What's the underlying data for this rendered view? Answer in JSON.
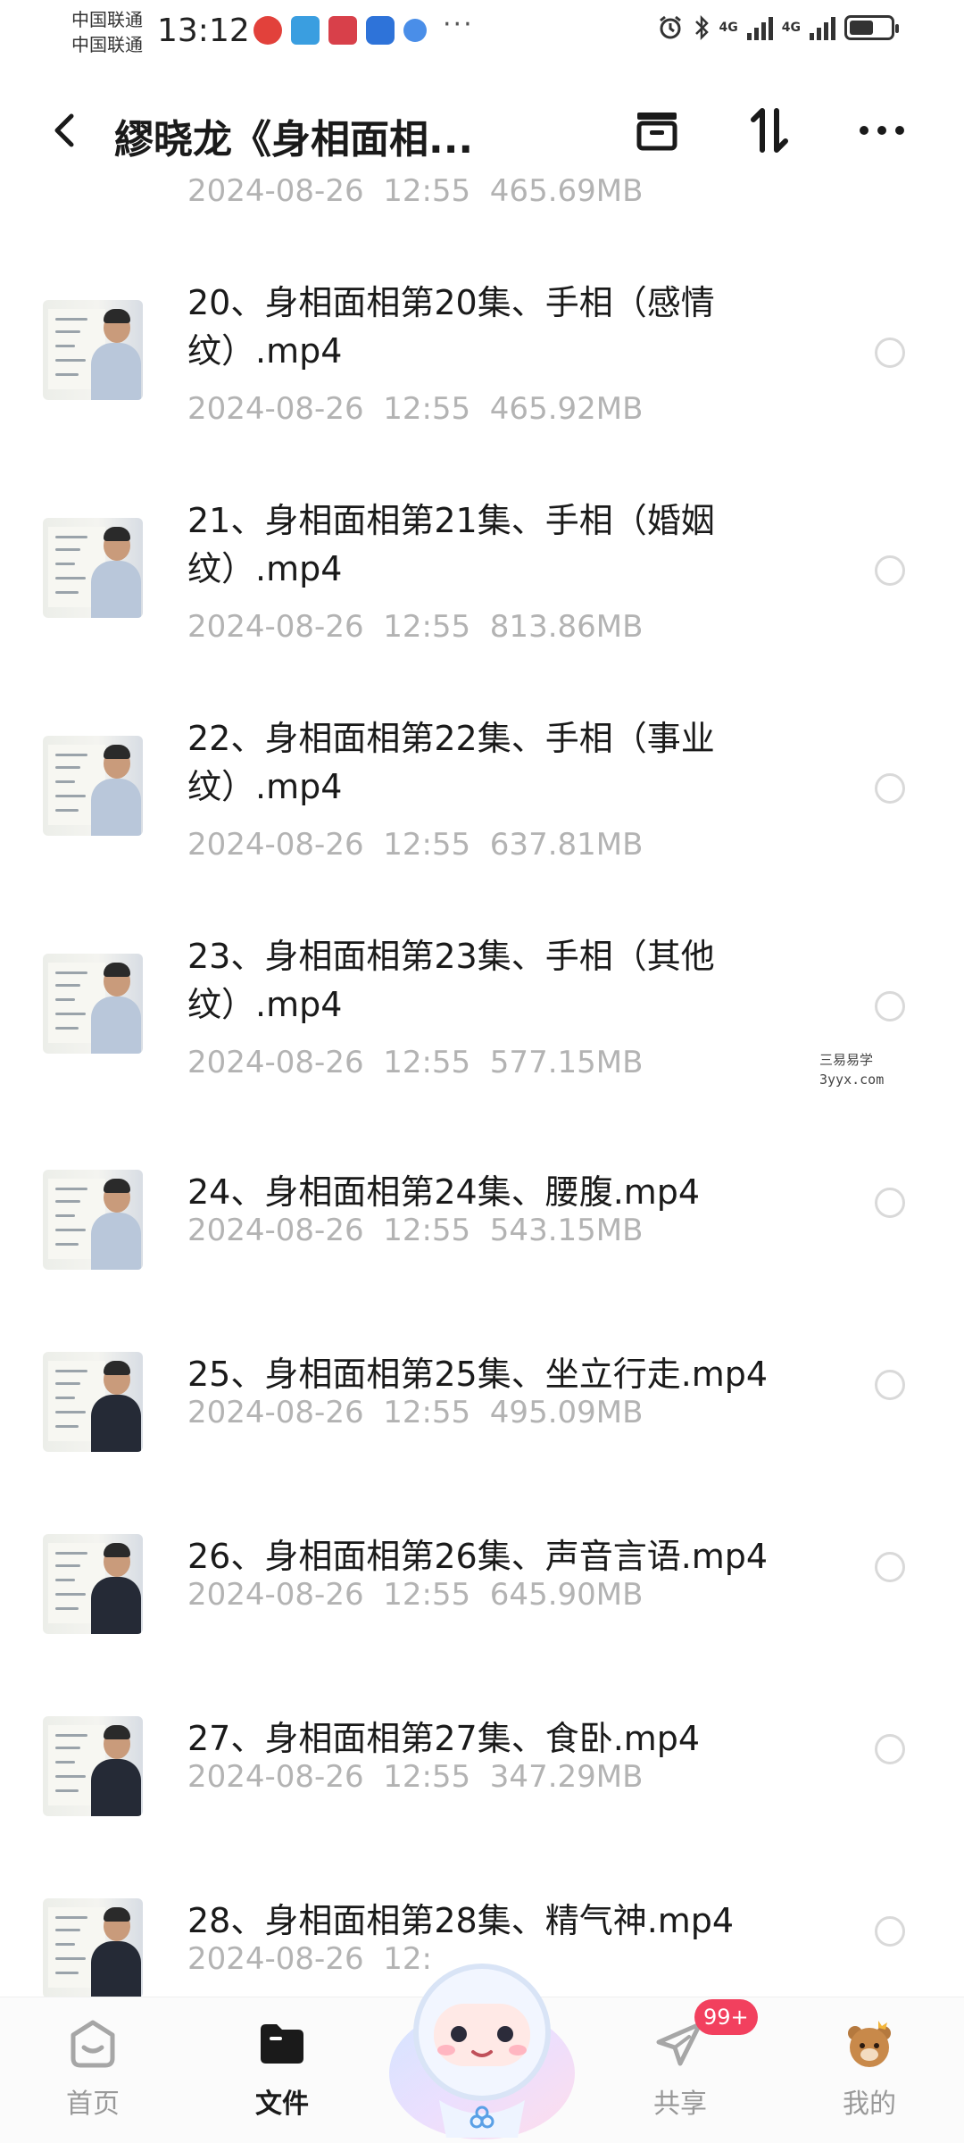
{
  "status_bar": {
    "carrier_1": "中国联通",
    "carrier_2": "中国联通",
    "time": "13:12",
    "network_1": "4G",
    "network_2": "4G",
    "more": "···",
    "battery_level": 0.6
  },
  "header": {
    "title": "繆晓龙《身相面相..."
  },
  "list": {
    "partial_item_meta": "2024-08-26  12:55  465.69MB",
    "items": [
      {
        "title": "20、身相面相第20集、手相（感情纹）.mp4",
        "meta": "2024-08-26  12:55  465.92MB"
      },
      {
        "title": "21、身相面相第21集、手相（婚姻纹）.mp4",
        "meta": "2024-08-26  12:55  813.86MB"
      },
      {
        "title": "22、身相面相第22集、手相（事业纹）.mp4",
        "meta": "2024-08-26  12:55  637.81MB"
      },
      {
        "title": "23、身相面相第23集、手相（其他纹）.mp4",
        "meta": "2024-08-26  12:55  577.15MB"
      },
      {
        "title": "24、身相面相第24集、腰腹.mp4",
        "meta": "2024-08-26  12:55  543.15MB"
      },
      {
        "title": "25、身相面相第25集、坐立行走.mp4",
        "meta": "2024-08-26  12:55  495.09MB"
      },
      {
        "title": "26、身相面相第26集、声音言语.mp4",
        "meta": "2024-08-26  12:55  645.90MB"
      },
      {
        "title": "27、身相面相第27集、食卧.mp4",
        "meta": "2024-08-26  12:55  347.29MB"
      },
      {
        "title": "28、身相面相第28集、精气神.mp4",
        "meta": "2024-08-26  12:"
      }
    ]
  },
  "watermark": {
    "line_1": "三易易学",
    "line_2": "3yyx.com"
  },
  "bottom_nav": {
    "home": "首页",
    "files": "文件",
    "share": "共享",
    "share_badge": "99+",
    "me": "我的"
  },
  "colors": {
    "accent_badge": "#f2405e",
    "meta_text": "#b3b3b3"
  }
}
